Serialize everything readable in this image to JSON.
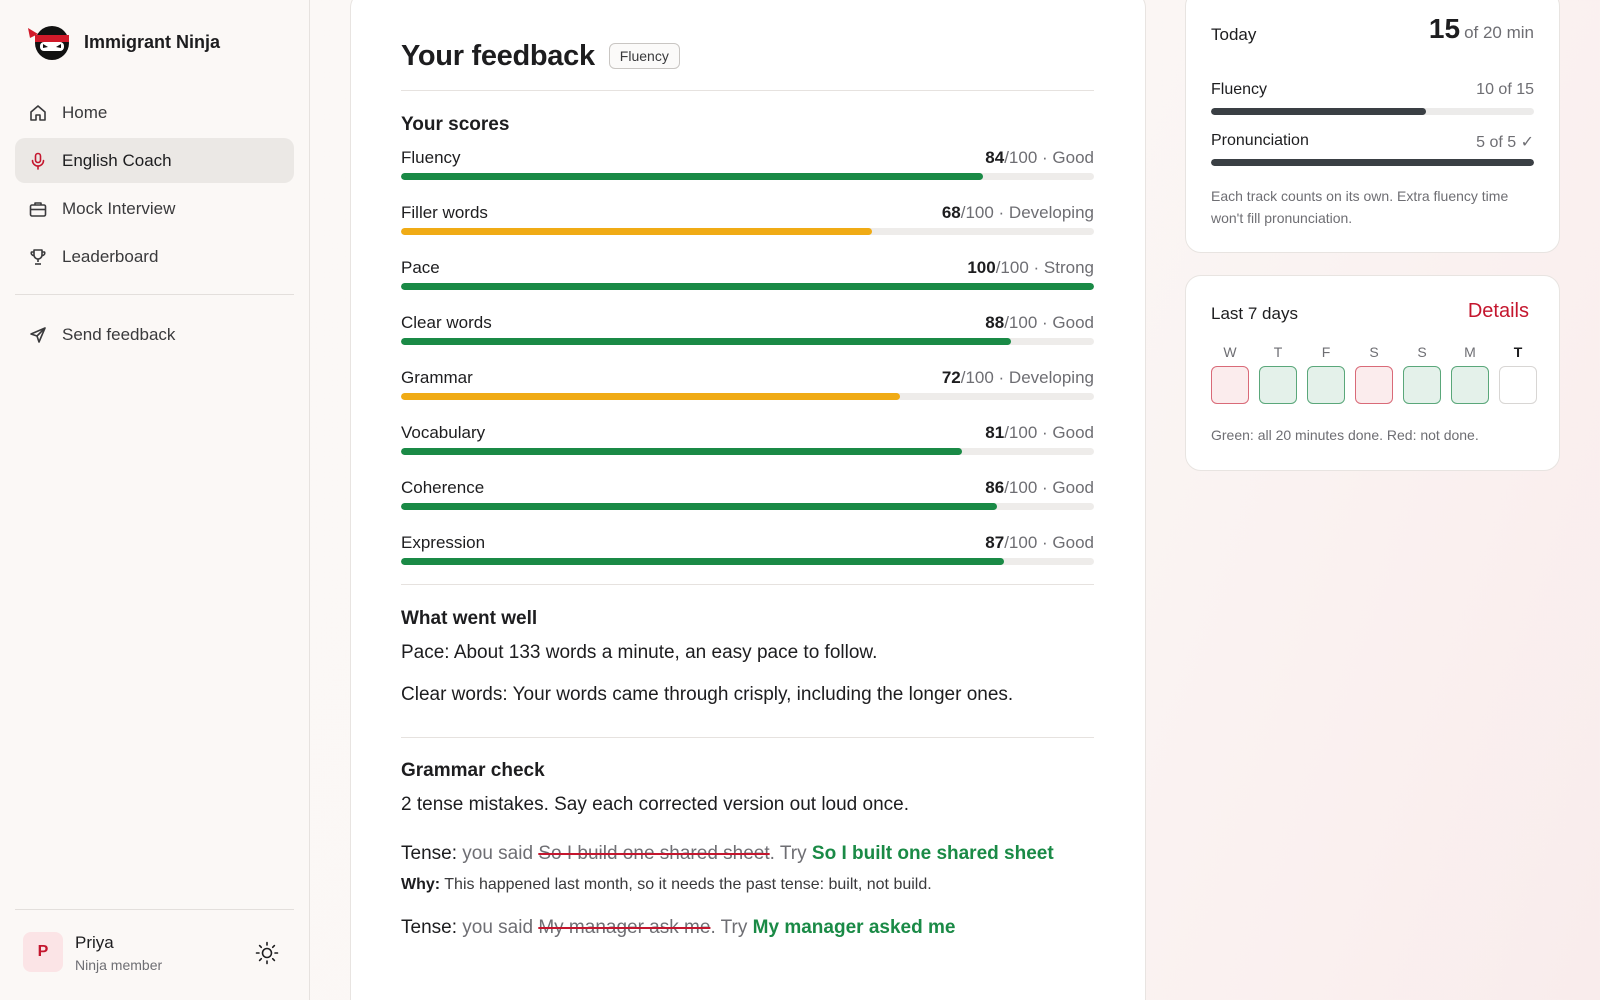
{
  "brand": {
    "name": "Immigrant Ninja"
  },
  "nav": {
    "items": [
      {
        "label": "Home",
        "icon": "home-icon"
      },
      {
        "label": "English Coach",
        "icon": "microphone-icon",
        "active": true
      },
      {
        "label": "Mock Interview",
        "icon": "briefcase-icon"
      },
      {
        "label": "Leaderboard",
        "icon": "trophy-icon"
      }
    ],
    "secondary": [
      {
        "label": "Send feedback",
        "icon": "send-icon"
      }
    ]
  },
  "user": {
    "initial": "P",
    "name": "Priya",
    "role": "Ninja member"
  },
  "feedback": {
    "title": "Your feedback",
    "badge": "Fluency",
    "scores_heading": "Your scores",
    "scores": [
      {
        "label": "Fluency",
        "score": "84",
        "max": "/100",
        "level": " · Good",
        "color": "#1a8a46",
        "fraction": 0.84
      },
      {
        "label": "Filler words",
        "score": "68",
        "max": "/100",
        "level": " · Developing",
        "color": "#f0ab15",
        "fraction": 0.68
      },
      {
        "label": "Pace",
        "score": "100",
        "max": "/100",
        "level": " · Strong",
        "color": "#1a8a46",
        "fraction": 1.0
      },
      {
        "label": "Clear words",
        "score": "88",
        "max": "/100",
        "level": " · Good",
        "color": "#1a8a46",
        "fraction": 0.88
      },
      {
        "label": "Grammar",
        "score": "72",
        "max": "/100",
        "level": " · Developing",
        "color": "#f0ab15",
        "fraction": 0.72
      },
      {
        "label": "Vocabulary",
        "score": "81",
        "max": "/100",
        "level": " · Good",
        "color": "#1a8a46",
        "fraction": 0.81
      },
      {
        "label": "Coherence",
        "score": "86",
        "max": "/100",
        "level": " · Good",
        "color": "#1a8a46",
        "fraction": 0.86
      },
      {
        "label": "Expression",
        "score": "87",
        "max": "/100",
        "level": " · Good",
        "color": "#1a8a46",
        "fraction": 0.87
      }
    ],
    "went_well_heading": "What went well",
    "went_well": [
      "Pace: About 133 words a minute, an easy pace to follow.",
      "Clear words: Your words came through crisply, including the longer ones."
    ],
    "grammar_heading": "Grammar check",
    "grammar_intro": "2 tense mistakes. Say each corrected version out loud once.",
    "corrections": [
      {
        "type": "Tense:",
        "said_prefix": " you said ",
        "said": "So I build one shared sheet",
        "try_prefix": ". Try ",
        "fix": "So I built one shared sheet",
        "why_label": "Why:",
        "why": " This happened last month, so it needs the past tense: built, not build."
      },
      {
        "type": "Tense:",
        "said_prefix": " you said ",
        "said": "My manager ask me",
        "try_prefix": ". Try ",
        "fix": "My manager asked me"
      }
    ]
  },
  "today": {
    "label": "Today",
    "done": "15",
    "of": "of 20 min",
    "tracks": [
      {
        "label": "Fluency",
        "value": "10 of 15",
        "fraction": 0.667
      },
      {
        "label": "Pronunciation",
        "value": "5 of 5 ✓",
        "fraction": 1.0
      }
    ],
    "note": "Each track counts on its own. Extra fluency time won't fill pronunciation."
  },
  "week": {
    "title": "Last 7 days",
    "details_label": "Details",
    "days": [
      {
        "letter": "W",
        "status": "red"
      },
      {
        "letter": "T",
        "status": "green"
      },
      {
        "letter": "F",
        "status": "green"
      },
      {
        "letter": "S",
        "status": "red"
      },
      {
        "letter": "S",
        "status": "green"
      },
      {
        "letter": "M",
        "status": "green"
      },
      {
        "letter": "T",
        "status": "none",
        "today": true
      }
    ],
    "legend": "Green: all 20 minutes done. Red: not done."
  },
  "colors": {
    "accent": "#c4162e",
    "good": "#1a8a46",
    "developing": "#f0ab15"
  }
}
